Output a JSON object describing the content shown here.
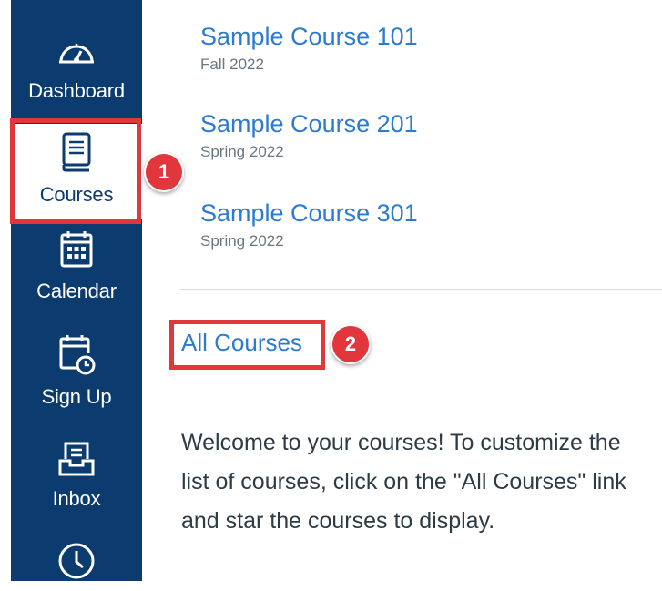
{
  "sidebar": {
    "items": [
      {
        "label": "Dashboard",
        "icon": "dashboard-icon"
      },
      {
        "label": "Courses",
        "icon": "courses-book-icon",
        "active": true
      },
      {
        "label": "Calendar",
        "icon": "calendar-icon"
      },
      {
        "label": "Sign Up",
        "icon": "signup-calendar-clock-icon"
      },
      {
        "label": "Inbox",
        "icon": "inbox-icon"
      },
      {
        "label": "",
        "icon": "history-clock-icon"
      }
    ]
  },
  "courses": [
    {
      "name": "Sample Course 101",
      "term": "Fall 2022"
    },
    {
      "name": "Sample Course 201",
      "term": "Spring 2022"
    },
    {
      "name": "Sample Course 301",
      "term": "Spring 2022"
    }
  ],
  "all_courses_label": "All Courses",
  "welcome_text": "Welcome to your courses! To customize the list of courses, click on the \"All Courses\" link and star the courses to display.",
  "annotations": {
    "step1": "1",
    "step2": "2"
  },
  "colors": {
    "sidebar_bg": "#0b3b6f",
    "link": "#2d7bd1",
    "highlight": "#e0363c"
  }
}
